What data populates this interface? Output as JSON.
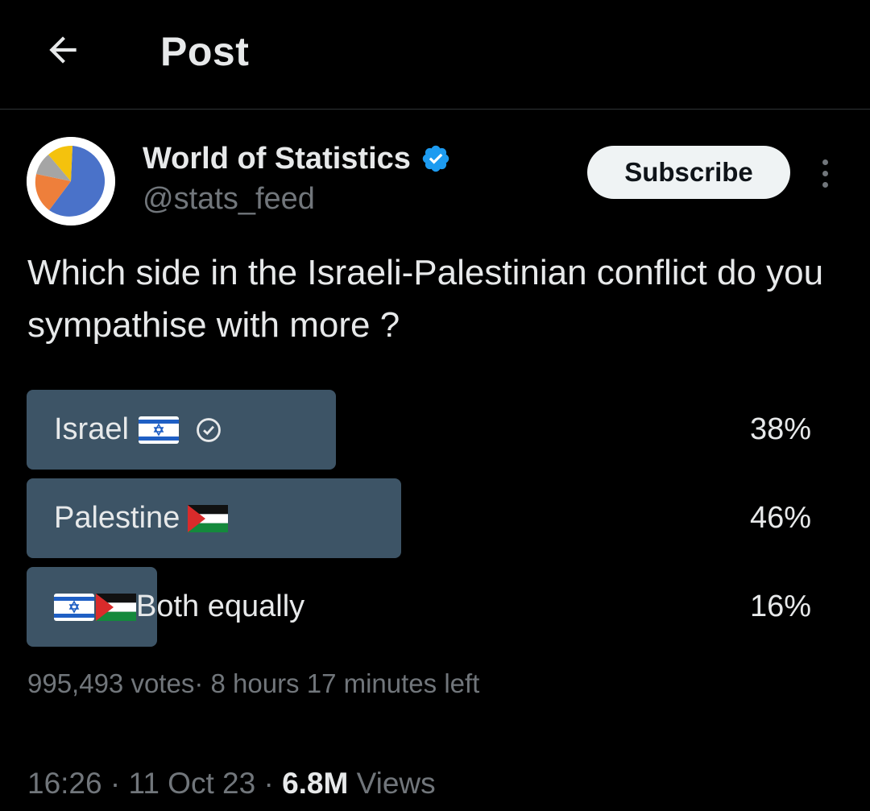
{
  "header": {
    "title": "Post"
  },
  "author": {
    "name": "World of Statistics",
    "handle": "@stats_feed",
    "verified": true
  },
  "subscribe_label": "Subscribe",
  "post": {
    "text": "Which side in the Israeli-Palestinian conflict do you sympathise with more ?"
  },
  "poll": {
    "options": [
      {
        "label": "Israel",
        "flags": [
          "israel-flag-icon"
        ],
        "percent_label": "38%",
        "percent": 38,
        "selected": true
      },
      {
        "label": "Palestine",
        "flags": [
          "palestine-flag-icon"
        ],
        "percent_label": "46%",
        "percent": 46,
        "selected": false
      },
      {
        "label": "Both equally",
        "flags": [
          "israel-flag-icon",
          "palestine-flag-icon"
        ],
        "percent_label": "16%",
        "percent": 16,
        "selected": false
      }
    ],
    "meta": "995,493 votes· 8 hours 17 minutes left"
  },
  "footer": {
    "time": "16:26",
    "date": "11 Oct 23",
    "views_count": "6.8M",
    "views_label": "Views"
  },
  "colors": {
    "background": "#000000",
    "text": "#e7e9ea",
    "muted": "#71767b",
    "poll_bar": "#3d5466",
    "verified": "#1d9bf0",
    "subscribe_bg": "#eff3f4"
  }
}
